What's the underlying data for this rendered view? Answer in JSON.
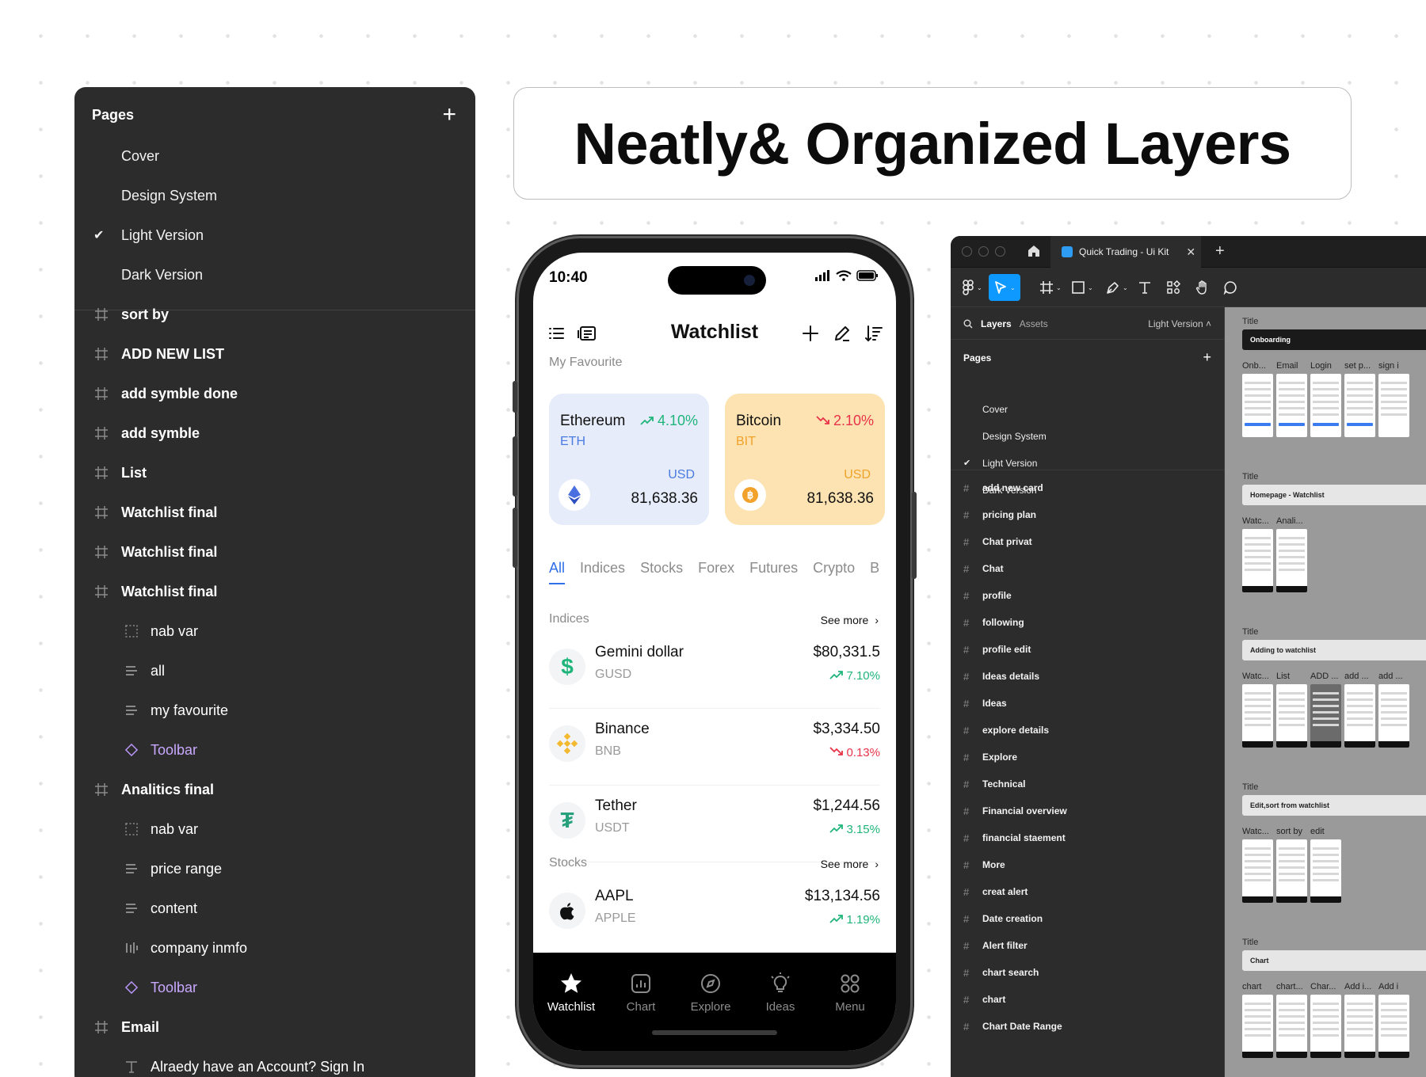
{
  "left_panel": {
    "title": "Pages",
    "pages": [
      {
        "label": "Cover",
        "checked": false
      },
      {
        "label": "Design System",
        "checked": false
      },
      {
        "label": "Light Version",
        "checked": true
      },
      {
        "label": "Dark Version",
        "checked": false
      }
    ],
    "layers": [
      {
        "label": "sort by",
        "kind": "frame"
      },
      {
        "label": "ADD NEW LIST",
        "kind": "frame"
      },
      {
        "label": "add symble done",
        "kind": "frame"
      },
      {
        "label": "add symble",
        "kind": "frame"
      },
      {
        "label": "List",
        "kind": "frame"
      },
      {
        "label": "Watchlist final",
        "kind": "frame"
      },
      {
        "label": "Watchlist final",
        "kind": "frame"
      },
      {
        "label": "Watchlist final",
        "kind": "frame"
      },
      {
        "label": "nab var",
        "kind": "group"
      },
      {
        "label": "all",
        "kind": "text-stack"
      },
      {
        "label": "my favourite",
        "kind": "text-stack"
      },
      {
        "label": "Toolbar",
        "kind": "component"
      },
      {
        "label": "Analitics final",
        "kind": "frame"
      },
      {
        "label": "nab var",
        "kind": "group"
      },
      {
        "label": "price range",
        "kind": "text-stack"
      },
      {
        "label": "content",
        "kind": "text-stack"
      },
      {
        "label": "company inmfo",
        "kind": "columns"
      },
      {
        "label": "Toolbar",
        "kind": "component"
      },
      {
        "label": "Email",
        "kind": "frame"
      },
      {
        "label": "Alraedy have an Account? Sign In",
        "kind": "text"
      }
    ]
  },
  "headline": "Neatly& Organized Layers",
  "phone": {
    "time": "10:40",
    "title": "Watchlist",
    "favourite_label": "My Favourite",
    "favourites": [
      {
        "name": "Ethereum",
        "symbol": "ETH",
        "change": "4.10%",
        "direction": "up",
        "currency": "USD",
        "value": "81,638.36",
        "bg": "#e7ecfb",
        "accent": "#4a7be0",
        "icon": "ethereum-icon"
      },
      {
        "name": "Bitcoin",
        "symbol": "BIT",
        "change": "2.10%",
        "direction": "down",
        "currency": "USD",
        "value": "81,638.36",
        "bg": "#fde3b1",
        "accent": "#f0a22a",
        "icon": "bitcoin-icon"
      }
    ],
    "tabs": [
      "All",
      "Indices",
      "Stocks",
      "Forex",
      "Futures",
      "Crypto",
      "B"
    ],
    "indices_label": "Indices",
    "stocks_label": "Stocks",
    "see_more": "See more",
    "indices": [
      {
        "name": "Gemini dollar",
        "symbol": "GUSD",
        "price": "$80,331.5",
        "change": "7.10%",
        "direction": "up",
        "icon": "dollar-icon"
      },
      {
        "name": "Binance",
        "symbol": "BNB",
        "price": "$3,334.50",
        "change": "0.13%",
        "direction": "down",
        "icon": "binance-icon"
      },
      {
        "name": "Tether",
        "symbol": "USDT",
        "price": "$1,244.56",
        "change": "3.15%",
        "direction": "up",
        "icon": "tether-icon"
      }
    ],
    "stocks": [
      {
        "name": "AAPL",
        "symbol": "APPLE",
        "price": "$13,134.56",
        "change": "1.19%",
        "direction": "up",
        "icon": "apple-icon"
      }
    ],
    "nav": [
      {
        "label": "Watchlist",
        "icon": "star-icon",
        "active": true
      },
      {
        "label": "Chart",
        "icon": "chart-icon",
        "active": false
      },
      {
        "label": "Explore",
        "icon": "compass-icon",
        "active": false
      },
      {
        "label": "Ideas",
        "icon": "bulb-icon",
        "active": false
      },
      {
        "label": "Menu",
        "icon": "grid-icon",
        "active": false
      }
    ]
  },
  "figma": {
    "tab_title": "Quick Trading - Ui Kit",
    "layers_tab": "Layers",
    "assets_tab": "Assets",
    "version": "Light Version",
    "pages_title": "Pages",
    "pages": [
      {
        "label": "Cover",
        "checked": false
      },
      {
        "label": "Design System",
        "checked": false
      },
      {
        "label": "Light Version",
        "checked": true
      },
      {
        "label": "Dark Version",
        "checked": false
      }
    ],
    "layers": [
      "add new card",
      "pricing plan",
      "Chat privat",
      "Chat",
      "profile",
      "following",
      "profile edit",
      "Ideas details",
      "Ideas",
      "explore details",
      "Explore",
      "Technical",
      "Financial overview",
      "financial staement",
      "More",
      "creat alert",
      "Date creation",
      "Alert filter",
      "chart search",
      "chart",
      "Chart Date Range"
    ],
    "canvas_sections": [
      {
        "title": "Title",
        "bar": "Onboarding",
        "dark": true,
        "labels": [
          "Onb...",
          "Email",
          "Login",
          "set p...",
          "sign i"
        ],
        "thumbs": 5
      },
      {
        "title": "Title",
        "bar": "Homepage - Watchlist",
        "dark": false,
        "labels": [
          "Watc...",
          "Anali..."
        ],
        "thumbs": 2
      },
      {
        "title": "Title",
        "bar": "Adding to watchlist",
        "dark": false,
        "labels": [
          "Watc...",
          "List",
          "ADD ...",
          "add ...",
          "add ..."
        ],
        "thumbs": 5
      },
      {
        "title": "Title",
        "bar": "Edit,sort from watchlist",
        "dark": false,
        "labels": [
          "Watc...",
          "sort by",
          "edit"
        ],
        "thumbs": 3
      },
      {
        "title": "Title",
        "bar": "Chart",
        "dark": false,
        "labels": [
          "chart",
          "chart...",
          "Char...",
          "Add i...",
          "Add i"
        ],
        "thumbs": 5
      }
    ]
  }
}
